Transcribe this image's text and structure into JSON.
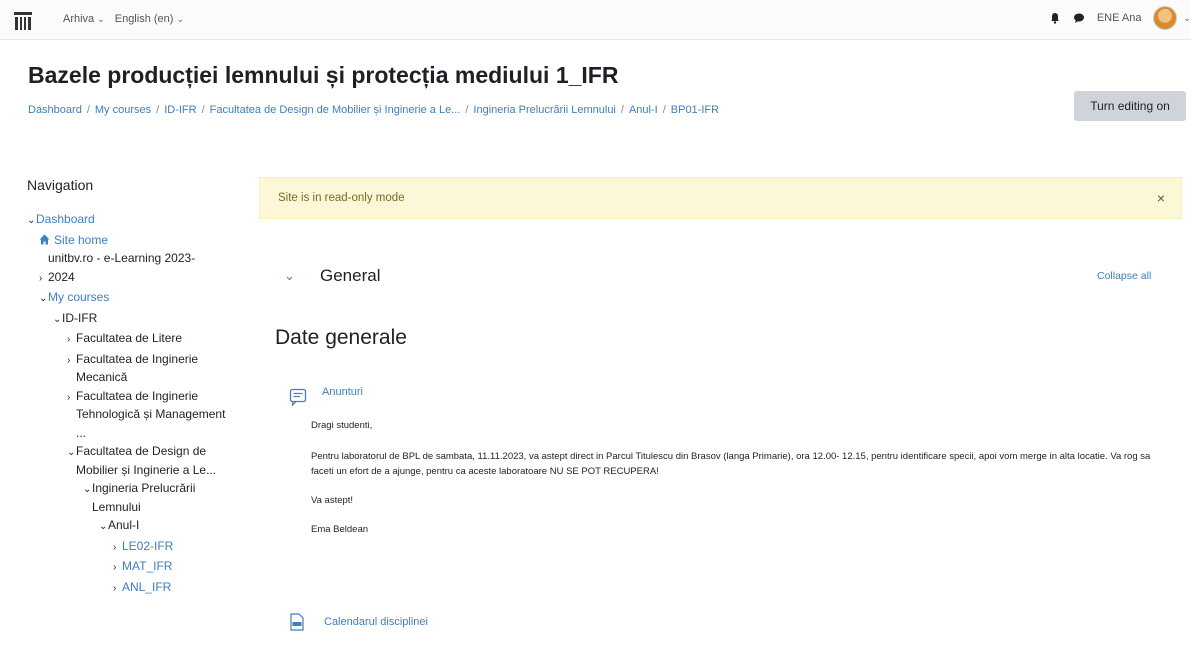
{
  "topbar": {
    "menu_archive": "Arhiva",
    "menu_language": "English (en)",
    "user_name": "ENE Ana"
  },
  "header": {
    "title": "Bazele producției lemnului și protecția mediului 1_IFR",
    "breadcrumb": [
      "Dashboard",
      "My courses",
      "ID-IFR",
      "Facultatea de Design de Mobilier și Inginerie a Le...",
      "Ingineria Prelucrării Lemnului",
      "Anul-I",
      "BP01-IFR"
    ],
    "edit_button": "Turn editing on"
  },
  "navigation": {
    "title": "Navigation",
    "items": [
      {
        "label": "Dashboard",
        "chevron": "v",
        "link": true
      },
      {
        "label": "Site home",
        "icon": "home-icon",
        "link": true
      },
      {
        "label": "unitbv.ro - e-Learning 2023-2024",
        "chevron": ">",
        "link": false
      },
      {
        "label": "My courses",
        "chevron": "v",
        "link": true
      },
      {
        "label": "ID-IFR",
        "chevron": "v",
        "link": false
      },
      {
        "label": "Facultatea de Litere",
        "chevron": ">",
        "link": false
      },
      {
        "label": "Facultatea de Inginerie Mecanică",
        "chevron": ">",
        "link": false
      },
      {
        "label": "Facultatea de Inginerie Tehnologică și Management ...",
        "chevron": ">",
        "link": false
      },
      {
        "label": "Facultatea de Design de Mobilier și Inginerie a Le...",
        "chevron": "v",
        "link": false
      },
      {
        "label": "Ingineria Prelucrării Lemnului",
        "chevron": "v",
        "link": false
      },
      {
        "label": "Anul-I",
        "chevron": "v",
        "link": false
      },
      {
        "label": "LE02-IFR",
        "chevron": ">",
        "link": true
      },
      {
        "label": "MAT_IFR",
        "chevron": ">",
        "link": true
      },
      {
        "label": "ANL_IFR",
        "chevron": ">",
        "link": true
      }
    ]
  },
  "alert": {
    "message": "Site is in read-only mode",
    "close": "×"
  },
  "section": {
    "toggle": "⌄",
    "title": "General",
    "collapse_all": "Collapse all",
    "subtitle": "Date generale"
  },
  "forum": {
    "link": "Anunturi",
    "greeting": "Dragi studenti,",
    "body": "Pentru laboratorul de BPL de sambata, 11.11.2023, va astept direct in Parcul Titulescu din Brasov (langa Primarie), ora 12.00- 12.15, pentru identificare specii, apoi vom merge in alta locatie. Va rog sa faceti un efort de a ajunge, pentru ca aceste laboratoare NU SE POT RECUPERA!",
    "closing": "Va astept!",
    "signature": "Ema Beldean"
  },
  "file": {
    "link": "Calendarul disciplinei"
  },
  "colors": {
    "link": "#3d7fbf",
    "alert_bg": "#fcf8d7",
    "button_bg": "#ced4da"
  }
}
